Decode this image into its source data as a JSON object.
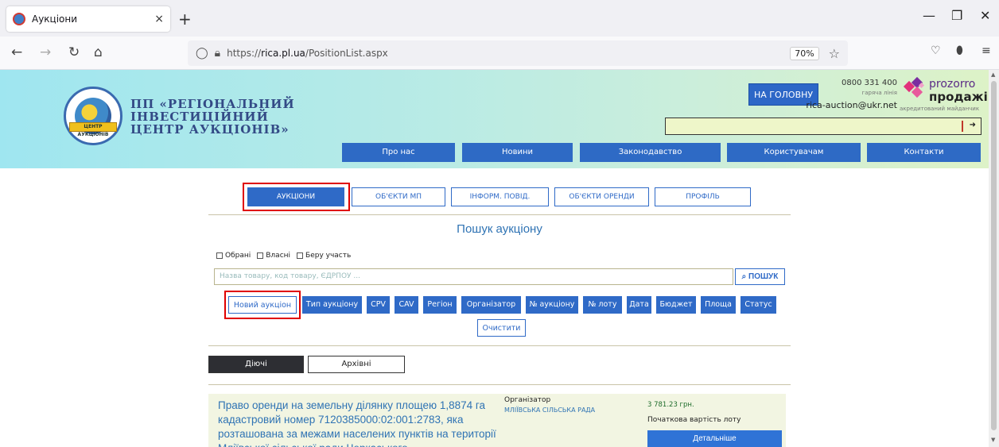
{
  "browser": {
    "tab_title": "Аукціони",
    "tab_close": "×",
    "new_tab": "+",
    "url_prefix": "https://",
    "url_host": "rica.pl.ua",
    "url_path": "/PositionList.aspx",
    "zoom": "70%"
  },
  "header": {
    "title_line1": "ПП «РЕГІОНАЛЬНИЙ",
    "title_line2": "ІНВЕСТИЦІЙНИЙ",
    "title_line3": "ЦЕНТР АУКЦІОНІВ»",
    "logo_text": "ЦЕНТР АУКЦІОНІВ",
    "home_button": "НА ГОЛОВНУ",
    "phone": "0800 331 400",
    "hotline_label": "гаряча лінія",
    "email": "rica-auction@ukr.net",
    "prozorro_line1": "prozorro",
    "prozorro_line2": "продажі",
    "prozorro_sub": "акредитований майданчик",
    "menu": [
      "Про нас",
      "Новини",
      "Законодавство",
      "Користувачам",
      "Контакти"
    ]
  },
  "page_tabs": [
    "АУКЦІОНИ",
    "ОБ'ЄКТИ МП",
    "ІНФОРМ. ПОВІД.",
    "ОБ'ЄКТИ ОРЕНДИ",
    "ПРОФІЛЬ"
  ],
  "heading": "Пошук аукціону",
  "checkboxes": [
    "Обрані",
    "Власні",
    "Беру участь"
  ],
  "search": {
    "placeholder": "Назва товару, код товару, ЄДРПОУ ...",
    "button": "ПОШУК"
  },
  "filters": [
    "Новий аукціон",
    "Тип аукціону",
    "CPV",
    "CAV",
    "Регіон",
    "Організатор",
    "№ аукціону",
    "№ лоту",
    "Дата",
    "Бюджет",
    "Площа",
    "Статус"
  ],
  "clear_button": "Очистити",
  "state_tabs": [
    "Діючі",
    "Архівні"
  ],
  "lot": {
    "title": "Право оренди на земельну ділянку площею 1,8874 га кадастровий номер 7120385000:02:001:2783, яка розташована за межами населених пунктів на території Мліївської сільської ради Черкаського",
    "organizer_label": "Організатор",
    "organizer": "МЛІЇВСЬКА СІЛЬСЬКА РАДА",
    "price": "3 781.23 грн.",
    "price_label": "Початкова вартість лоту",
    "details_button": "Детальніше"
  },
  "colors": {
    "accent": "#2f6ac7",
    "highlight_box": "#e00000",
    "header_gradient_start": "#9fe6f0",
    "header_gradient_end": "#ddf2c7"
  }
}
